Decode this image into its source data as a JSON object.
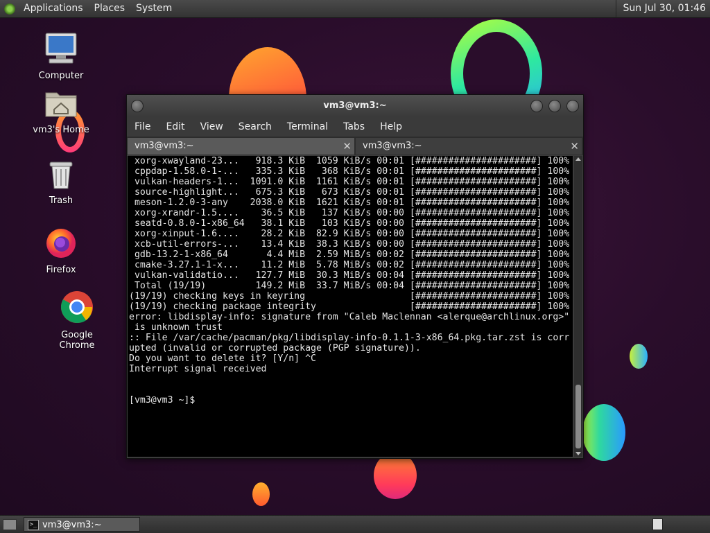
{
  "top_panel": {
    "menus": [
      "Applications",
      "Places",
      "System"
    ],
    "clock": "Sun Jul 30, 01:46"
  },
  "desktop_icons": [
    {
      "label": "Computer",
      "icon": "computer-icon"
    },
    {
      "label": "vm3's Home",
      "icon": "home-folder-icon"
    },
    {
      "label": "Trash",
      "icon": "trash-icon"
    },
    {
      "label": "Firefox",
      "icon": "firefox-icon"
    },
    {
      "label": "Google Chrome",
      "icon": "chrome-icon"
    }
  ],
  "terminal": {
    "title": "vm3@vm3:~",
    "menu": [
      "File",
      "Edit",
      "View",
      "Search",
      "Terminal",
      "Tabs",
      "Help"
    ],
    "tabs": [
      {
        "label": "vm3@vm3:~",
        "active": true
      },
      {
        "label": "vm3@vm3:~",
        "active": false
      }
    ],
    "lines": [
      " xorg-xwayland-23...   918.3 KiB  1059 KiB/s 00:01 [######################] 100%",
      " cppdap-1.58.0-1-...   335.3 KiB   368 KiB/s 00:01 [######################] 100%",
      " vulkan-headers-1...  1091.0 KiB  1161 KiB/s 00:01 [######################] 100%",
      " source-highlight...   675.3 KiB   673 KiB/s 00:01 [######################] 100%",
      " meson-1.2.0-3-any    2038.0 KiB  1621 KiB/s 00:01 [######################] 100%",
      " xorg-xrandr-1.5....    36.5 KiB   137 KiB/s 00:00 [######################] 100%",
      " seatd-0.8.0-1-x86_64   38.1 KiB   103 KiB/s 00:00 [######################] 100%",
      " xorg-xinput-1.6....    28.2 KiB  82.9 KiB/s 00:00 [######################] 100%",
      " xcb-util-errors-...    13.4 KiB  38.3 KiB/s 00:00 [######################] 100%",
      " gdb-13.2-1-x86_64       4.4 MiB  2.59 MiB/s 00:02 [######################] 100%",
      " cmake-3.27.1-1-x...    11.2 MiB  5.78 MiB/s 00:02 [######################] 100%",
      " vulkan-validatio...   127.7 MiB  30.3 MiB/s 00:04 [######################] 100%",
      " Total (19/19)         149.2 MiB  33.7 MiB/s 00:04 [######################] 100%",
      "(19/19) checking keys in keyring                   [######################] 100%",
      "(19/19) checking package integrity                 [######################] 100%",
      "error: libdisplay-info: signature from \"Caleb Maclennan <alerque@archlinux.org>\"",
      " is unknown trust",
      ":: File /var/cache/pacman/pkg/libdisplay-info-0.1.1-3-x86_64.pkg.tar.zst is corr",
      "upted (invalid or corrupted package (PGP signature)).",
      "Do you want to delete it? [Y/n] ^C",
      "Interrupt signal received",
      "",
      "",
      "[vm3@vm3 ~]$ "
    ]
  },
  "taskbar": {
    "window_button": "vm3@vm3:~"
  },
  "colors": {
    "desktop_bg": "#2a0d2b",
    "panel_bg": "#3a3a3a",
    "terminal_bg": "#000000",
    "terminal_fg": "#e6e6e6"
  }
}
